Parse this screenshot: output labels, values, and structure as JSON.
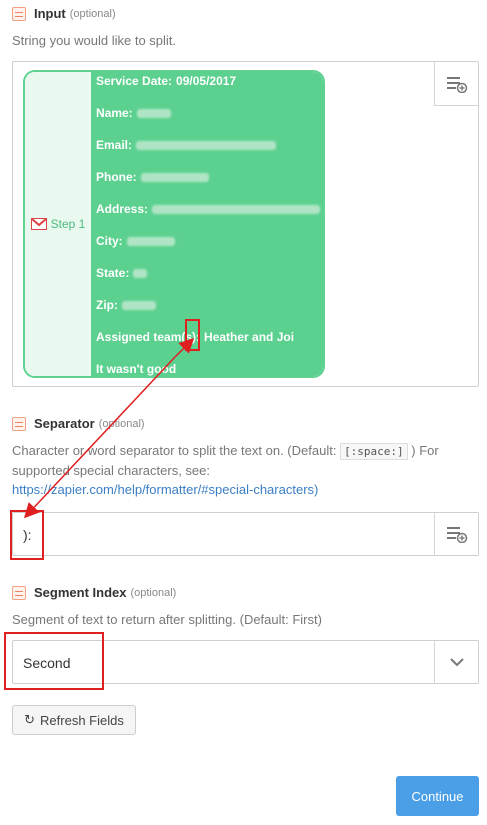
{
  "input_field": {
    "label": "Input",
    "optional": "(optional)",
    "help": "String you would like to split.",
    "step_label": "Step 1",
    "lines": [
      {
        "key": "Service Date:",
        "value": "09/05/2017",
        "blur_w": 0
      },
      {
        "key": "Name:",
        "value": "",
        "blur_w": 34
      },
      {
        "key": "Email:",
        "value": "",
        "blur_w": 140
      },
      {
        "key": "Phone:",
        "value": "",
        "blur_w": 68
      },
      {
        "key": "Address:",
        "value": "",
        "blur_w": 168
      },
      {
        "key": "City:",
        "value": "",
        "blur_w": 48
      },
      {
        "key": "State:",
        "value": "",
        "blur_w": 14
      },
      {
        "key": "Zip:",
        "value": "",
        "blur_w": 34
      },
      {
        "key": "Assigned team(s):",
        "value": "Heather and Joi",
        "blur_w": 0
      },
      {
        "key": "It wasn't good",
        "value": "",
        "blur_w": 0
      }
    ]
  },
  "separator_field": {
    "label": "Separator",
    "optional": "(optional)",
    "help_pre": "Character or word separator to split the text on. (Default:",
    "help_code": "[:space:]",
    "help_post": ") For supported special characters, see:",
    "help_link": "https://zapier.com/help/formatter/#special-characters)",
    "value": "):"
  },
  "segment_field": {
    "label": "Segment Index",
    "optional": "(optional)",
    "help": "Segment of text to return after splitting. (Default: First)",
    "value": "Second"
  },
  "buttons": {
    "refresh": "Refresh Fields",
    "continue": "Continue"
  },
  "colors": {
    "pill_green": "#5cd08f",
    "annotation_red": "#e02020",
    "primary_blue": "#4a9fe6"
  }
}
